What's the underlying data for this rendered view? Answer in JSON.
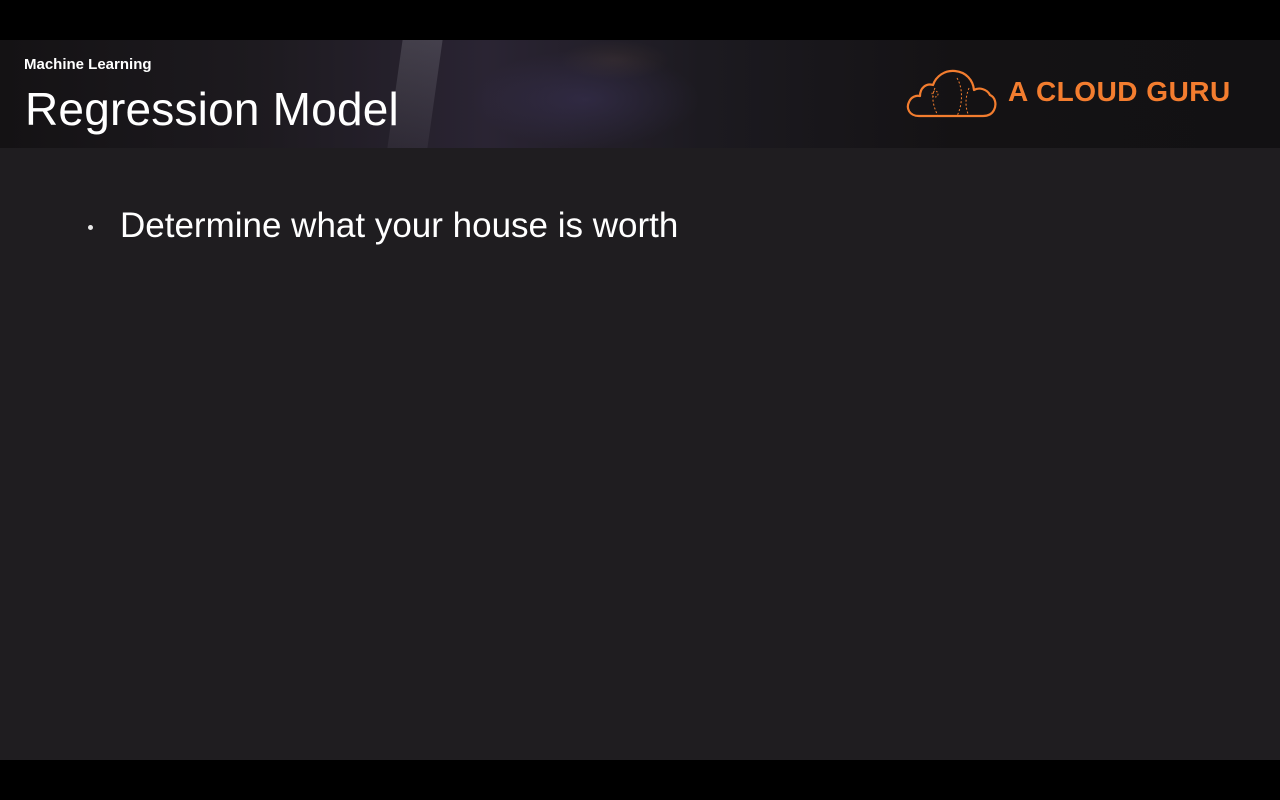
{
  "slide": {
    "subtitle": "Machine Learning",
    "title": "Regression Model",
    "logo": {
      "text": "A CLOUD GURU",
      "icon": "cloud-icon",
      "color": "#f37d2f"
    },
    "bullets": [
      {
        "text": "Determine what your house is worth"
      }
    ]
  },
  "colors": {
    "slide_background": "#1f1d20",
    "letterbox": "#000000",
    "text": "#ffffff",
    "accent": "#f37d2f"
  }
}
